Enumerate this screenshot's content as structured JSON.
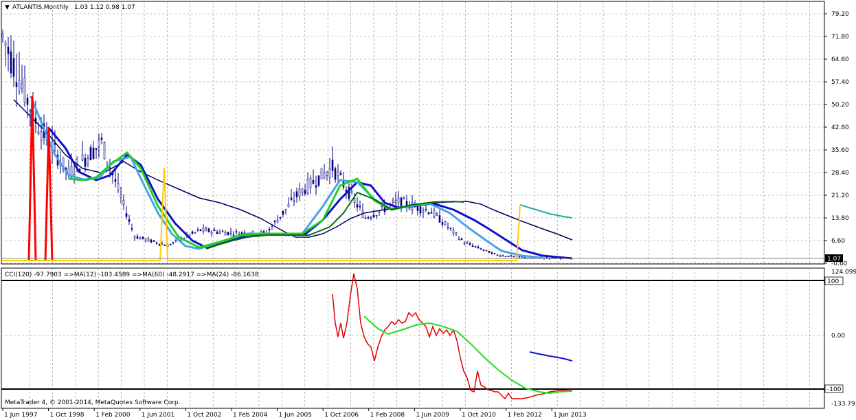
{
  "main_pane": {
    "title": "ATLANTIS,Monthly",
    "ohlc": "1.03 1.12 0.98 1.07",
    "last_price_label": "1.07",
    "y_ticks": [
      "79.20",
      "71.80",
      "64.60",
      "57.40",
      "50.20",
      "42.80",
      "35.60",
      "28.40",
      "21.20",
      "13.80",
      "6.60",
      "-0.60"
    ],
    "y_tick_values": [
      79.2,
      71.8,
      64.6,
      57.4,
      50.2,
      42.8,
      35.6,
      28.4,
      21.2,
      13.8,
      6.6,
      -0.6
    ]
  },
  "cci_pane": {
    "header": "CCI(120) -97.7903  =>MA(12) -103.4589  =>MA(60) -48.2917  =>MA(24) -86.1638",
    "y_ticks": [
      "124.0991",
      "100",
      "0.00",
      "-100",
      "-133.793"
    ],
    "copyright": "MetaTrader 4, © 2001-2014, MetaQuotes Software Corp."
  },
  "x_axis": {
    "labels": [
      "1 Jun 1997",
      "1 Oct 1998",
      "1 Feb 2000",
      "1 Jun 2001",
      "1 Oct 2002",
      "1 Feb 2004",
      "1 Jun 2005",
      "1 Oct 2006",
      "1 Feb 2008",
      "1 Jun 2009",
      "1 Oct 2010",
      "1 Feb 2012",
      "1 Jun 2013"
    ]
  },
  "colors": {
    "background": "#ffffff",
    "grid": "#7f7f7f",
    "candles": "#000080",
    "sma_fast": "#4aa3e8",
    "sma_blue": "#1010c8",
    "sma_navy": "#000060",
    "sma_green": "#22d022",
    "sma_darkgreen": "#0b6b0b",
    "teal": "#20b0a0",
    "red_signal": "#ff0000",
    "yellow_signal": "#ffcc00",
    "cci_line": "#e00000",
    "cci_ma_green": "#22dd22",
    "cci_ma_blue": "#1010c8"
  },
  "chart_data": {
    "type": "line",
    "x": [
      "1997-06",
      "1998-06",
      "1999-06",
      "2000-06",
      "2001-06",
      "2002-06",
      "2003-06",
      "2004-06",
      "2005-06",
      "2006-06",
      "2007-06",
      "2008-06",
      "2009-06",
      "2010-06",
      "2011-06",
      "2012-06",
      "2013-06",
      "2013-12"
    ],
    "series": [
      {
        "name": "ATLANTIS",
        "values": [
          72,
          45,
          28,
          38,
          8,
          5,
          10,
          9,
          9,
          22,
          30,
          14,
          19,
          16,
          6,
          2,
          1.1,
          1.07
        ]
      }
    ],
    "ylim": [
      -0.6,
      79.2
    ],
    "cci": {
      "x": [
        "2006-07",
        "2006-10",
        "2007-02",
        "2007-06",
        "2007-10",
        "2008-02",
        "2008-06",
        "2008-10",
        "2009-02",
        "2009-06",
        "2009-10",
        "2010-02",
        "2010-06",
        "2010-10",
        "2011-02",
        "2011-06",
        "2011-10",
        "2012-02",
        "2012-06",
        "2012-10",
        "2013-02",
        "2013-06",
        "2013-10"
      ],
      "values": [
        55,
        -5,
        40,
        124,
        70,
        0,
        -40,
        10,
        20,
        5,
        35,
        5,
        10,
        0,
        -40,
        -90,
        -100,
        -100,
        -120,
        -125,
        -120,
        -110,
        -98
      ],
      "ma12": [
        null,
        null,
        null,
        null,
        null,
        null,
        35,
        20,
        10,
        8,
        12,
        15,
        20,
        18,
        10,
        -20,
        -50,
        -80,
        -95,
        -105,
        -105,
        -103,
        -103
      ],
      "ma_blue": [
        null,
        null,
        null,
        null,
        null,
        null,
        null,
        null,
        null,
        null,
        null,
        null,
        null,
        null,
        null,
        null,
        null,
        null,
        null,
        -40,
        -45,
        -48,
        -48
      ],
      "ylim": [
        -133.793,
        124.0991
      ]
    }
  }
}
